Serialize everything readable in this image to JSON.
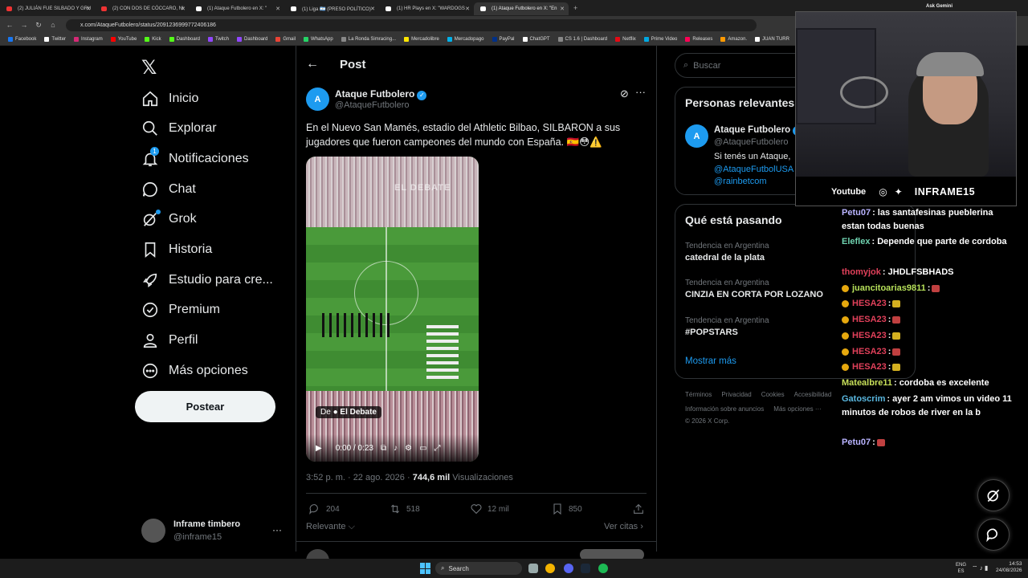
{
  "browser": {
    "tabs": [
      {
        "label": "(2) JULIÁN FUE SILBADO Y GRU",
        "color": "#e33"
      },
      {
        "label": "(2) CON DOS DE CÓCCARO, NI",
        "color": "#e33"
      },
      {
        "label": "(1) Ataque Futbolero en X: \"",
        "color": "#fff"
      },
      {
        "label": "(1) Liga 🇦🇷 (PRESO POLÍTICO)",
        "color": "#fff"
      },
      {
        "label": "(1) HR Plays en X: \"WARDOGS",
        "color": "#fff"
      },
      {
        "label": "(1) Ataque Futbolero en X: \"En",
        "color": "#fff",
        "active": true
      }
    ],
    "ask_gemini": "Ask Gemini",
    "url": "x.com/AtaqueFutbolero/status/2091236999772406186",
    "bookmarks": [
      {
        "label": "Facebook",
        "color": "#1877f2"
      },
      {
        "label": "Twitter",
        "color": "#fff"
      },
      {
        "label": "Instagram",
        "color": "#d62976"
      },
      {
        "label": "YouTube",
        "color": "#f00"
      },
      {
        "label": "Kick",
        "color": "#53fc18"
      },
      {
        "label": "Dashboard",
        "color": "#53fc18"
      },
      {
        "label": "Twitch",
        "color": "#9146ff"
      },
      {
        "label": "Dashboard",
        "color": "#9146ff"
      },
      {
        "label": "Gmail",
        "color": "#ea4335"
      },
      {
        "label": "WhatsApp",
        "color": "#25d366"
      },
      {
        "label": "La Ronda Simracing...",
        "color": "#888"
      },
      {
        "label": "Mercadolibre",
        "color": "#ffe600"
      },
      {
        "label": "Mercadopago",
        "color": "#00b1ea"
      },
      {
        "label": "PayPal",
        "color": "#003087"
      },
      {
        "label": "ChatGPT",
        "color": "#fff"
      },
      {
        "label": "CS 1.6 | Dashboard",
        "color": "#888"
      },
      {
        "label": "Netflix",
        "color": "#e50914"
      },
      {
        "label": "Prime Video",
        "color": "#00a8e1"
      },
      {
        "label": "Releases",
        "color": "#f05"
      },
      {
        "label": "Amazon.",
        "color": "#f90"
      },
      {
        "label": "JUAN TURR",
        "color": "#fff"
      }
    ]
  },
  "sidebar": {
    "logo": "𝕏",
    "items": [
      {
        "label": "Inicio",
        "icon": "home-icon"
      },
      {
        "label": "Explorar",
        "icon": "search-icon"
      },
      {
        "label": "Notificaciones",
        "icon": "bell-icon",
        "badge": "1"
      },
      {
        "label": "Chat",
        "icon": "chat-icon"
      },
      {
        "label": "Grok",
        "icon": "grok-icon"
      },
      {
        "label": "Historia",
        "icon": "bookmark-icon"
      },
      {
        "label": "Estudio para cre...",
        "icon": "rocket-icon"
      },
      {
        "label": "Premium",
        "icon": "verified-icon"
      },
      {
        "label": "Perfil",
        "icon": "user-icon"
      },
      {
        "label": "Más opciones",
        "icon": "more-icon"
      }
    ],
    "post_button": "Postear",
    "account": {
      "name": "Inframe timbero",
      "handle": "@inframe15",
      "more": "···"
    }
  },
  "post": {
    "header_title": "Post",
    "author": {
      "name": "Ataque Futbolero",
      "handle": "@AtaqueFutbolero"
    },
    "text": "En el Nuevo San Mamés, estadio del Athletic Bilbao, SILBARON a sus jugadores que fueron campeones del mundo con España. 🇪🇸😳⚠️",
    "video": {
      "source_prefix": "De",
      "source": "El Debate",
      "time": "0:00 / 0:23",
      "overlay_text": "EL DEBATE"
    },
    "meta": {
      "time": "3:52 p. m. · 22 ago. 2026 · ",
      "views": "744,6 mil",
      "views_label": " Visualizaciones"
    },
    "actions": {
      "replies": "204",
      "reposts": "518",
      "likes": "12 mil",
      "bookmarks": "850"
    },
    "sort": "Relevante",
    "see_quotes": "Ver citas"
  },
  "right": {
    "search_placeholder": "Buscar",
    "relevant": {
      "title": "Personas relevantes",
      "name": "Ataque Futbolero",
      "handle": "@AtaqueFutbolero",
      "bio_1": "Si tenés un Ataque,",
      "bio_2": "@AtaqueFutbolUSA",
      "bio_3": "@rainbetcom"
    },
    "happening": {
      "title": "Qué está pasando",
      "trends": [
        {
          "context": "Tendencia en Argentina",
          "name": "catedral de la plata"
        },
        {
          "context": "Tendencia en Argentina",
          "name": "CINZIA EN CORTA POR LOZANO"
        },
        {
          "context": "Tendencia en Argentina",
          "name": "#POPSTARS"
        }
      ],
      "show_more": "Mostrar más"
    },
    "footer": {
      "line1": [
        "Términos",
        "Privacidad",
        "Cookies",
        "Accesibilidad"
      ],
      "line2": [
        "Información sobre anuncios",
        "Más opciones ···"
      ],
      "copy": "© 2026 X Corp."
    }
  },
  "stream": {
    "socials": "Youtube",
    "channel": "INFRAME15",
    "chat": [
      {
        "user": "Petu07",
        "color": "#b9b3ff",
        "msg": ": las santafesinas pueblerina estan todas buenas"
      },
      {
        "user": "Eleflex",
        "color": "#6fd3b0",
        "msg": ": Depende que parte de cordoba"
      },
      {
        "user": "thomyjok",
        "color": "#e0405a",
        "msg": ": JHDLFSBHADS"
      },
      {
        "user": "juancitoarias9811",
        "color": "#b6e05a",
        "msg": ":"
      },
      {
        "user": "HESA23",
        "color": "#e0405a",
        "msg": ":"
      },
      {
        "user": "HESA23",
        "color": "#e0405a",
        "msg": ":"
      },
      {
        "user": "HESA23",
        "color": "#e0405a",
        "msg": ":"
      },
      {
        "user": "HESA23",
        "color": "#e0405a",
        "msg": ":"
      },
      {
        "user": "HESA23",
        "color": "#e0405a",
        "msg": ":"
      },
      {
        "user": "Matealbre11",
        "color": "#c8e05a",
        "msg": ": cordoba es excelente"
      },
      {
        "user": "Gatoscrim",
        "color": "#5ab8e0",
        "msg": ": ayer 2 am vimos un video 11 minutos de robos de river en la b"
      },
      {
        "user": "Petu07",
        "color": "#b9b3ff",
        "msg": ":"
      }
    ]
  },
  "taskbar": {
    "search": "Search",
    "lang_1": "ENG",
    "lang_2": "ES",
    "time": "14:53",
    "date": "24/08/2026"
  }
}
